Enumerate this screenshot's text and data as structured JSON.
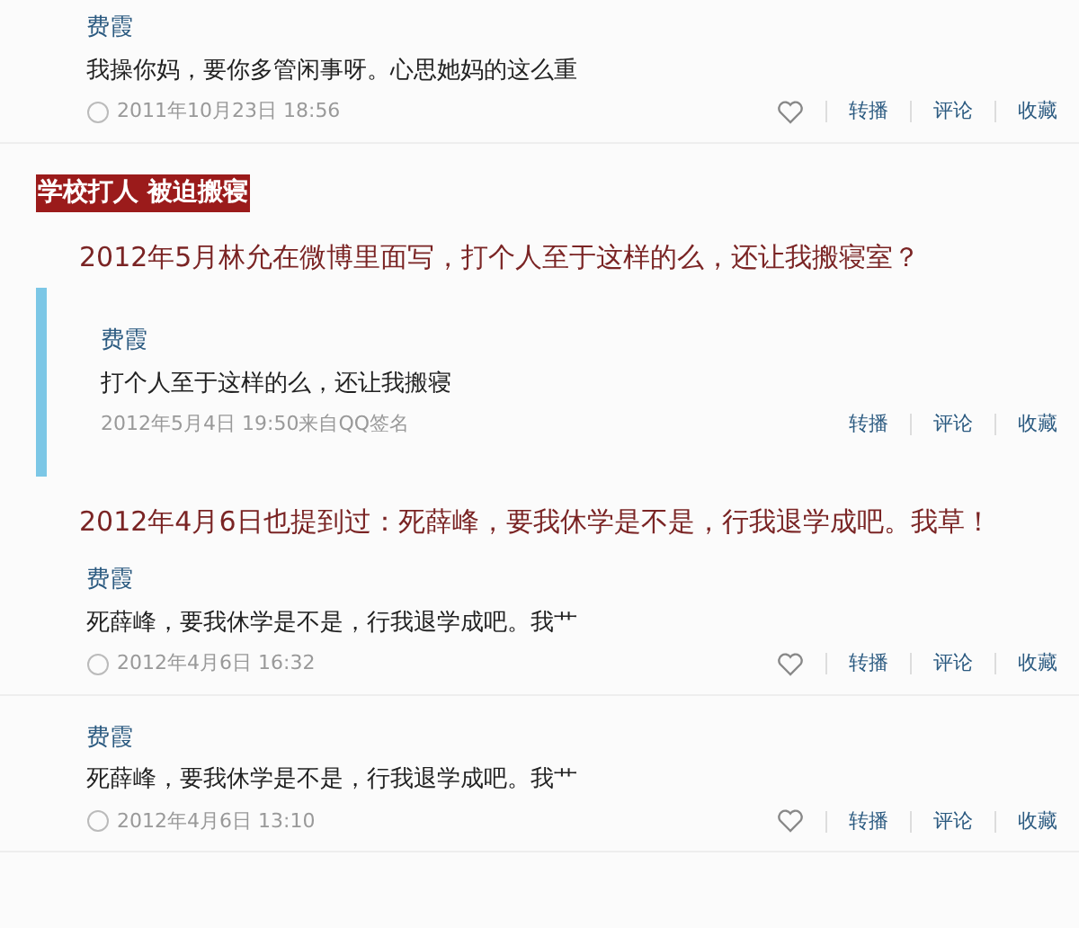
{
  "items": [
    {
      "kind": "post",
      "author": "费霞",
      "text": "我操你妈，要你多管闲事呀。心思她妈的这么重",
      "time": "2011年10月23日 18:56",
      "like": true,
      "actions": [
        "转播",
        "评论",
        "收藏"
      ]
    },
    {
      "kind": "banner",
      "text": "学校打人 被迫搬寝"
    },
    {
      "kind": "caption",
      "text": "2012年5月林允在微博里面写，打个人至于这样的么，还让我搬寝室？"
    },
    {
      "kind": "quote",
      "author": "费霞",
      "text": "打个人至于这样的么，还让我搬寝",
      "time": "2012年5月4日 19:50来自QQ签名",
      "actions": [
        "转播",
        "评论",
        "收藏"
      ]
    },
    {
      "kind": "caption",
      "text": "2012年4月6日也提到过：死薛峰，要我休学是不是，行我退学成吧。我草！"
    },
    {
      "kind": "post",
      "author": "费霞",
      "text": "死薛峰，要我休学是不是，行我退学成吧。我艹",
      "time": "2012年4月6日 16:32",
      "like": true,
      "actions": [
        "转播",
        "评论",
        "收藏"
      ]
    },
    {
      "kind": "post",
      "author": "费霞",
      "text": "死薛峰，要我休学是不是，行我退学成吧。我艹",
      "time": "2012年4月6日 13:10",
      "like": true,
      "actions": [
        "转播",
        "评论",
        "收藏"
      ]
    }
  ]
}
